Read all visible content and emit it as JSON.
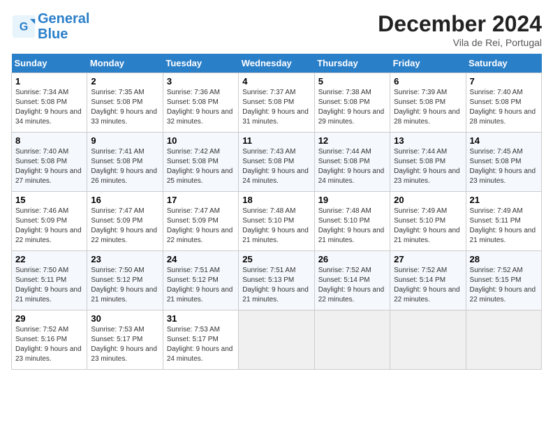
{
  "header": {
    "logo_line1": "General",
    "logo_line2": "Blue",
    "month_title": "December 2024",
    "location": "Vila de Rei, Portugal"
  },
  "weekdays": [
    "Sunday",
    "Monday",
    "Tuesday",
    "Wednesday",
    "Thursday",
    "Friday",
    "Saturday"
  ],
  "weeks": [
    [
      {
        "day": "1",
        "sunrise": "7:34 AM",
        "sunset": "5:08 PM",
        "daylight": "9 hours and 34 minutes."
      },
      {
        "day": "2",
        "sunrise": "7:35 AM",
        "sunset": "5:08 PM",
        "daylight": "9 hours and 33 minutes."
      },
      {
        "day": "3",
        "sunrise": "7:36 AM",
        "sunset": "5:08 PM",
        "daylight": "9 hours and 32 minutes."
      },
      {
        "day": "4",
        "sunrise": "7:37 AM",
        "sunset": "5:08 PM",
        "daylight": "9 hours and 31 minutes."
      },
      {
        "day": "5",
        "sunrise": "7:38 AM",
        "sunset": "5:08 PM",
        "daylight": "9 hours and 29 minutes."
      },
      {
        "day": "6",
        "sunrise": "7:39 AM",
        "sunset": "5:08 PM",
        "daylight": "9 hours and 28 minutes."
      },
      {
        "day": "7",
        "sunrise": "7:40 AM",
        "sunset": "5:08 PM",
        "daylight": "9 hours and 28 minutes."
      }
    ],
    [
      {
        "day": "8",
        "sunrise": "7:40 AM",
        "sunset": "5:08 PM",
        "daylight": "9 hours and 27 minutes."
      },
      {
        "day": "9",
        "sunrise": "7:41 AM",
        "sunset": "5:08 PM",
        "daylight": "9 hours and 26 minutes."
      },
      {
        "day": "10",
        "sunrise": "7:42 AM",
        "sunset": "5:08 PM",
        "daylight": "9 hours and 25 minutes."
      },
      {
        "day": "11",
        "sunrise": "7:43 AM",
        "sunset": "5:08 PM",
        "daylight": "9 hours and 24 minutes."
      },
      {
        "day": "12",
        "sunrise": "7:44 AM",
        "sunset": "5:08 PM",
        "daylight": "9 hours and 24 minutes."
      },
      {
        "day": "13",
        "sunrise": "7:44 AM",
        "sunset": "5:08 PM",
        "daylight": "9 hours and 23 minutes."
      },
      {
        "day": "14",
        "sunrise": "7:45 AM",
        "sunset": "5:08 PM",
        "daylight": "9 hours and 23 minutes."
      }
    ],
    [
      {
        "day": "15",
        "sunrise": "7:46 AM",
        "sunset": "5:09 PM",
        "daylight": "9 hours and 22 minutes."
      },
      {
        "day": "16",
        "sunrise": "7:47 AM",
        "sunset": "5:09 PM",
        "daylight": "9 hours and 22 minutes."
      },
      {
        "day": "17",
        "sunrise": "7:47 AM",
        "sunset": "5:09 PM",
        "daylight": "9 hours and 22 minutes."
      },
      {
        "day": "18",
        "sunrise": "7:48 AM",
        "sunset": "5:10 PM",
        "daylight": "9 hours and 21 minutes."
      },
      {
        "day": "19",
        "sunrise": "7:48 AM",
        "sunset": "5:10 PM",
        "daylight": "9 hours and 21 minutes."
      },
      {
        "day": "20",
        "sunrise": "7:49 AM",
        "sunset": "5:10 PM",
        "daylight": "9 hours and 21 minutes."
      },
      {
        "day": "21",
        "sunrise": "7:49 AM",
        "sunset": "5:11 PM",
        "daylight": "9 hours and 21 minutes."
      }
    ],
    [
      {
        "day": "22",
        "sunrise": "7:50 AM",
        "sunset": "5:11 PM",
        "daylight": "9 hours and 21 minutes."
      },
      {
        "day": "23",
        "sunrise": "7:50 AM",
        "sunset": "5:12 PM",
        "daylight": "9 hours and 21 minutes."
      },
      {
        "day": "24",
        "sunrise": "7:51 AM",
        "sunset": "5:12 PM",
        "daylight": "9 hours and 21 minutes."
      },
      {
        "day": "25",
        "sunrise": "7:51 AM",
        "sunset": "5:13 PM",
        "daylight": "9 hours and 21 minutes."
      },
      {
        "day": "26",
        "sunrise": "7:52 AM",
        "sunset": "5:14 PM",
        "daylight": "9 hours and 22 minutes."
      },
      {
        "day": "27",
        "sunrise": "7:52 AM",
        "sunset": "5:14 PM",
        "daylight": "9 hours and 22 minutes."
      },
      {
        "day": "28",
        "sunrise": "7:52 AM",
        "sunset": "5:15 PM",
        "daylight": "9 hours and 22 minutes."
      }
    ],
    [
      {
        "day": "29",
        "sunrise": "7:52 AM",
        "sunset": "5:16 PM",
        "daylight": "9 hours and 23 minutes."
      },
      {
        "day": "30",
        "sunrise": "7:53 AM",
        "sunset": "5:17 PM",
        "daylight": "9 hours and 23 minutes."
      },
      {
        "day": "31",
        "sunrise": "7:53 AM",
        "sunset": "5:17 PM",
        "daylight": "9 hours and 24 minutes."
      },
      null,
      null,
      null,
      null
    ]
  ]
}
